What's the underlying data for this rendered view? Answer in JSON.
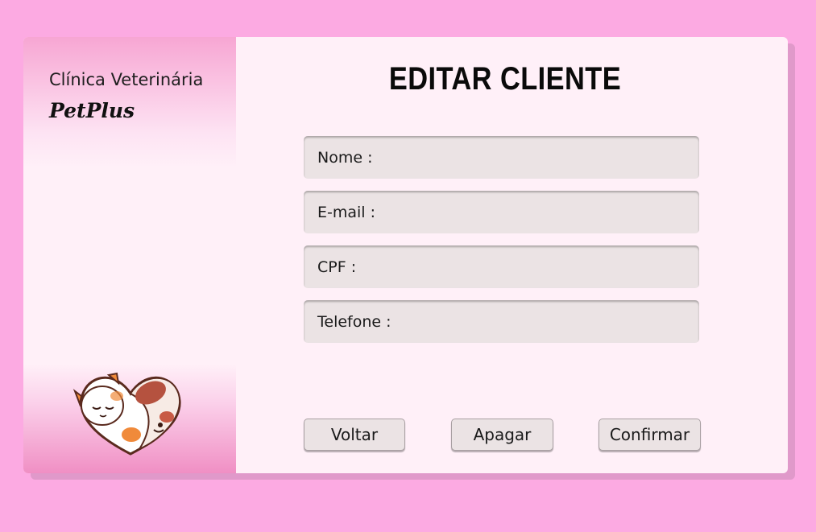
{
  "sidebar": {
    "brand_subtitle": "Clínica Veterinária",
    "brand_name": "PetPlus"
  },
  "main": {
    "title": "EDITAR CLIENTE",
    "fields": [
      {
        "label": "Nome :"
      },
      {
        "label": "E-mail :"
      },
      {
        "label": "CPF :"
      },
      {
        "label": "Telefone :"
      }
    ],
    "buttons": {
      "back": "Voltar",
      "delete": "Apagar",
      "confirm": "Confirmar"
    }
  },
  "colors": {
    "background": "#fcaae2",
    "card": "#fff0f8",
    "field": "#ebe3e4",
    "sidebar_accent": "#f08fc4"
  },
  "icons": {
    "mascot": "cat-and-dog-heart-logo"
  }
}
